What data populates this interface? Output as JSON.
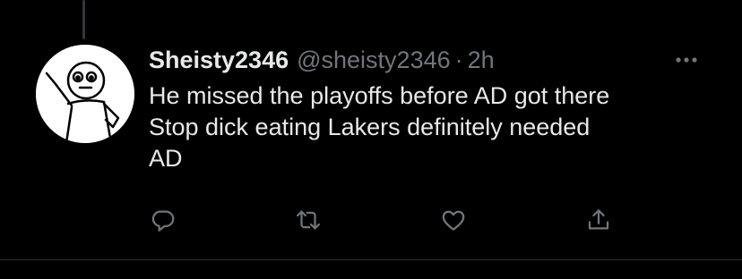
{
  "tweet": {
    "display_name": "Sheisty2346",
    "handle": "@sheisty2346",
    "separator": "·",
    "time": "2h",
    "text_lines": [
      "He missed the playoffs before AD got there",
      "Stop dick eating Lakers definitely needed",
      "AD"
    ]
  },
  "actions": [
    {
      "name": "reply",
      "icon": "reply-icon"
    },
    {
      "name": "retweet",
      "icon": "retweet-icon"
    },
    {
      "name": "like",
      "icon": "heart-icon"
    },
    {
      "name": "share",
      "icon": "share-icon"
    }
  ],
  "colors": {
    "background": "#000000",
    "primary_text": "#e7e9ea",
    "secondary_text": "#71767b",
    "divider": "#2f3336"
  }
}
